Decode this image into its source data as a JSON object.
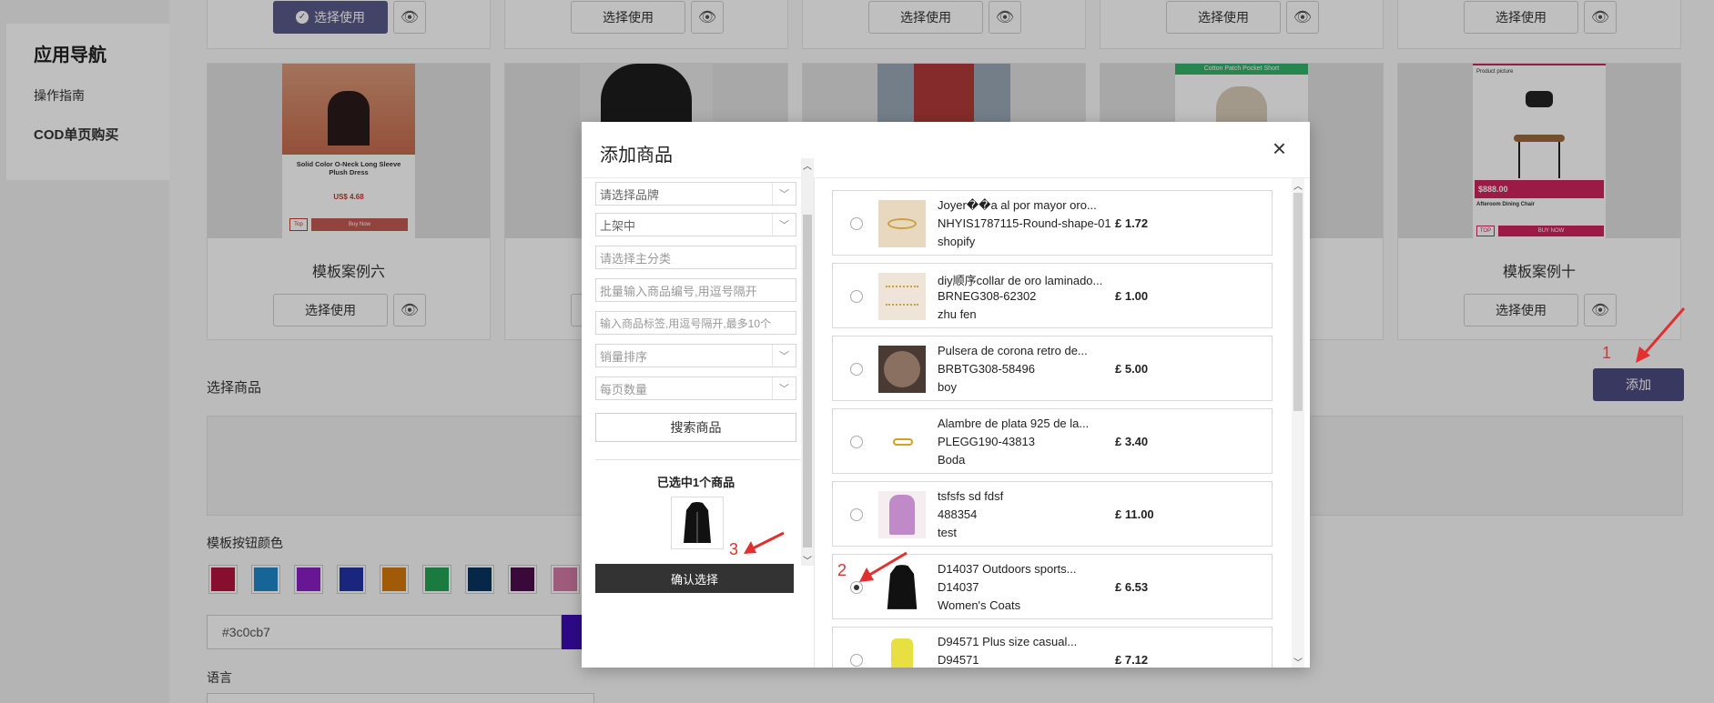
{
  "nav": {
    "title": "应用导航",
    "items": [
      "操作指南",
      "COD单页购买"
    ]
  },
  "templates": {
    "use_label": "选择使用",
    "card_titles": [
      "模板案例六",
      "模板案例十"
    ],
    "thumb_texts": {
      "dress": [
        "Solid Color O-Neck Long Sleeve",
        "Plush Dress"
      ],
      "dress_price": "US$ 4.68",
      "dress_buy": "Buy Now",
      "dress_top": "Top",
      "short": "Cotton Patch Pocket Short",
      "chair_head": "Product picture",
      "chair_price": "$888.00",
      "chair_name": "Afteroom Dining Chair",
      "chair_buy": "BUY NOW",
      "chair_top": "TOP"
    }
  },
  "section": {
    "choose_goods": "选择商品",
    "add_button": "添加",
    "button_color": "模板按钮颜色",
    "color_value": "#3c0cb7",
    "language": "语言"
  },
  "swatch_colors": [
    "#b5133f",
    "#1f86c9",
    "#8a1fc4",
    "#2332a8",
    "#d6780b",
    "#23a356",
    "#0a3463",
    "#4f0b4e",
    "#d47aa5"
  ],
  "modal": {
    "title": "添加商品",
    "close": "×",
    "filters": {
      "brand": "请选择品牌",
      "status": "上架中",
      "category": "请选择主分类",
      "codes": "批量输入商品编号,用逗号隔开",
      "tags": "输入商品标签,用逗号隔开,最多10个",
      "sort": "销量排序",
      "per_page": "每页数量"
    },
    "search_button": "搜索商品",
    "selected_title": "已选中1个商品",
    "confirm_button": "确认选择"
  },
  "products": [
    {
      "name": "Joyer��a al por mayor oro...",
      "code": "NHYIS1787115-Round-shape-01",
      "vendor": "shopify",
      "price": "£ 1.72",
      "checked": false
    },
    {
      "name": "diy顺序collar de oro laminado...",
      "code": "BRNEG308-62302",
      "vendor": "zhu fen",
      "price": "£ 1.00",
      "checked": false
    },
    {
      "name": "Pulsera de corona retro de...",
      "code": "BRBTG308-58496",
      "vendor": "boy",
      "price": "£ 5.00",
      "checked": false
    },
    {
      "name": "Alambre de plata 925 de la...",
      "code": "PLEGG190-43813",
      "vendor": "Boda",
      "price": "£ 3.40",
      "checked": false
    },
    {
      "name": "tsfsfs sd fdsf",
      "code": "488354",
      "vendor": "test",
      "price": "£ 11.00",
      "checked": false
    },
    {
      "name": "D14037 Outdoors sports...",
      "code": "D14037",
      "vendor": "Women's Coats",
      "price": "£ 6.53",
      "checked": true
    },
    {
      "name": "D94571 Plus size casual...",
      "code": "D94571",
      "vendor": "",
      "price": "£ 7.12",
      "checked": false
    }
  ],
  "annotations": [
    "1",
    "2",
    "3"
  ]
}
